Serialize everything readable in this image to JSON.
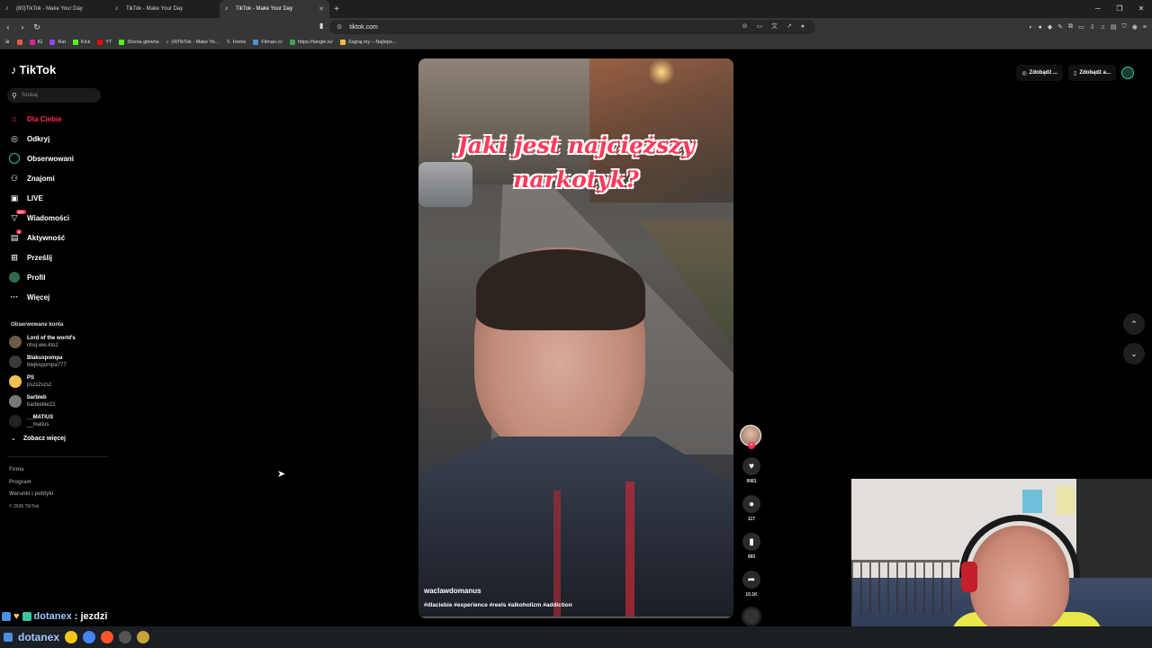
{
  "browser": {
    "tabs": [
      {
        "title": "(80)TikTok - Make Your Day",
        "active": false
      },
      {
        "title": "TikTok - Make Your Day",
        "active": false
      },
      {
        "title": "TikTok - Make Your Day",
        "active": true
      }
    ],
    "url": "tiktok.com",
    "bookmarks": [
      {
        "label": "IG",
        "color": "#d6249f"
      },
      {
        "label": "Rat",
        "color": "#9146ff"
      },
      {
        "label": "Kick",
        "color": "#53fc18"
      },
      {
        "label": "YT",
        "color": "#ff0000"
      },
      {
        "label": "Strona główna",
        "color": "#53fc18"
      },
      {
        "label": "(4)TikTok - Make Yo...",
        "color": "#ffffff"
      },
      {
        "label": "Home",
        "color": "#ffffff"
      },
      {
        "label": "Filman.cc",
        "color": "#4a90d9"
      },
      {
        "label": "https://tangle.io/",
        "color": "#3aa655"
      },
      {
        "label": "Zagraj.my – Najleps...",
        "color": "#f5b942"
      }
    ]
  },
  "sidebar": {
    "brand": "TikTok",
    "search_placeholder": "Szukaj",
    "nav": [
      {
        "label": "Dla Ciebie",
        "icon": "home-icon",
        "glyph": "⌂",
        "active": true
      },
      {
        "label": "Odkryj",
        "icon": "compass-icon",
        "glyph": "◎"
      },
      {
        "label": "Obserwowani",
        "icon": "following-icon",
        "glyph": ""
      },
      {
        "label": "Znajomi",
        "icon": "friends-icon",
        "glyph": "⚇"
      },
      {
        "label": "LIVE",
        "icon": "live-icon",
        "glyph": "▣"
      },
      {
        "label": "Wiadomości",
        "icon": "messages-icon",
        "glyph": "▽",
        "badge": "99+"
      },
      {
        "label": "Aktywność",
        "icon": "activity-icon",
        "glyph": "▤",
        "badge": "4"
      },
      {
        "label": "Prześlij",
        "icon": "upload-icon",
        "glyph": "⊞"
      },
      {
        "label": "Profil",
        "icon": "profile-icon",
        "glyph": ""
      },
      {
        "label": "Więcej",
        "icon": "more-icon",
        "glyph": "···"
      }
    ],
    "following_title": "Obserwowane konta",
    "following": [
      {
        "name": "Lord of the world's",
        "handle": "chuj.wie.kto2"
      },
      {
        "name": "Blakuxpompa",
        "handle": "blejkxpompa777"
      },
      {
        "name": "PS",
        "handle": "pszszszsz"
      },
      {
        "name": "barbieb",
        "handle": "barbiebie22"
      },
      {
        "name": "__MATIUS",
        "handle": "__matius"
      }
    ],
    "see_more": "Zobacz więcej",
    "footer": [
      "Firma",
      "Program",
      "Warunki i polityki"
    ],
    "copyright": "© 2026 TikTok"
  },
  "video": {
    "overlay_line1": "Jaki jest najcięższy",
    "overlay_line2": "narkotyk?",
    "author": "waclawdomanus",
    "hashtags": "#dlaciebie #experience #reels #alkoholizm #addiction",
    "progress": 0.0
  },
  "actions": {
    "likes": "9081",
    "comments": "117",
    "saves": "965",
    "shares": "10.1K"
  },
  "topbar": {
    "btn1": "Zdobądź ...",
    "btn2": "Zdobądź a..."
  },
  "chat": {
    "name": "dotanex",
    "message": ": jezdzi",
    "taskbar_name": "dotanex"
  },
  "colors": {
    "accent": "#fe2c55",
    "background": "#000000"
  }
}
